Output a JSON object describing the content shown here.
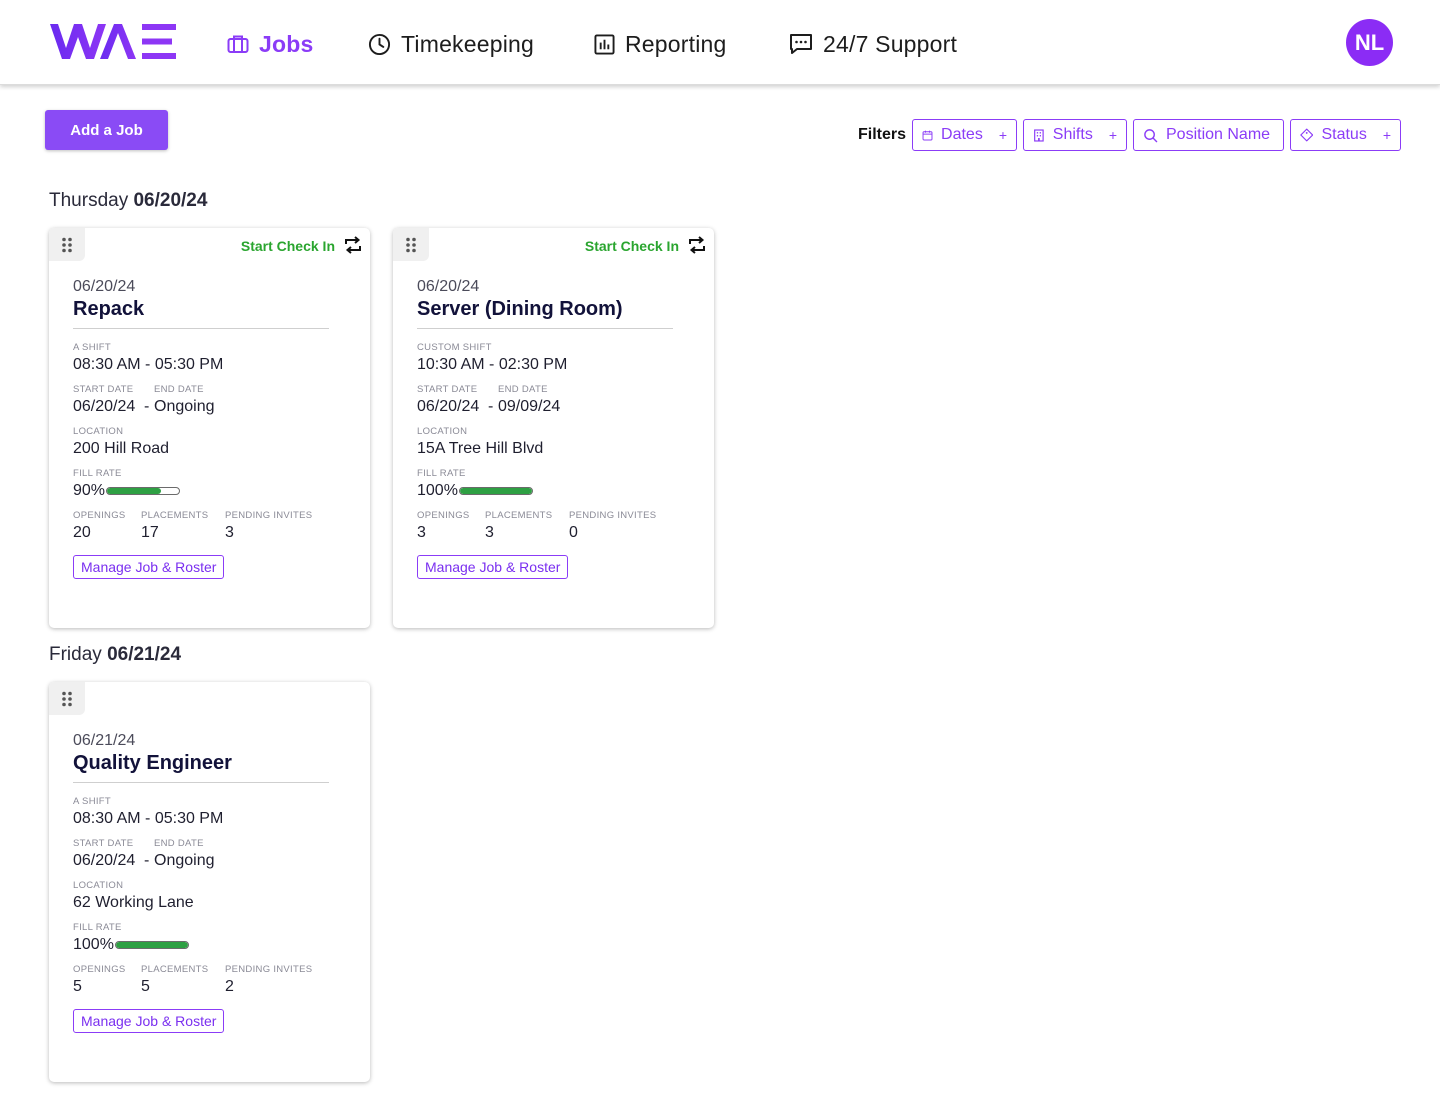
{
  "brand": {
    "logo_text": "WAE",
    "accent": "#8b3cf7",
    "success": "#2ea043"
  },
  "nav": {
    "items": [
      {
        "label": "Jobs",
        "icon": "briefcase-icon",
        "active": true
      },
      {
        "label": "Timekeeping",
        "icon": "clock-icon",
        "active": false
      },
      {
        "label": "Reporting",
        "icon": "bar-chart-icon",
        "active": false
      },
      {
        "label": "24/7 Support",
        "icon": "chat-icon",
        "active": false
      }
    ],
    "avatar_initials": "NL"
  },
  "toolbar": {
    "add_label": "Add a Job",
    "filters_label": "Filters",
    "filters": [
      {
        "label": "Dates",
        "icon": "calendar-icon"
      },
      {
        "label": "Shifts",
        "icon": "building-icon"
      },
      {
        "label": "Position Name",
        "icon": "search-icon"
      },
      {
        "label": "Status",
        "icon": "diamond-icon"
      }
    ]
  },
  "days": [
    {
      "weekday": "Thursday",
      "date": "06/20/24",
      "jobs": [
        {
          "checkin_label": "Start Check In",
          "date": "06/20/24",
          "title": "Repack",
          "shift_label": "A SHIFT",
          "shift_time": "08:30 AM - 05:30 PM",
          "start_date_label": "START DATE",
          "end_date_label": "END DATE",
          "start_date": "06/20/24",
          "end_date": "Ongoing",
          "location_label": "LOCATION",
          "location": "200 Hill Road",
          "fill_rate_label": "FILL RATE",
          "fill_rate": "90%",
          "fill_fraction": 0.75,
          "openings_label": "OPENINGS",
          "openings": "20",
          "placements_label": "PLACEMENTS",
          "placements": "17",
          "pending_label": "PENDING INVITES",
          "pending": "3",
          "manage_label": "Manage Job & Roster"
        },
        {
          "checkin_label": "Start Check In",
          "date": "06/20/24",
          "title": "Server (Dining Room)",
          "shift_label": "CUSTOM SHIFT",
          "shift_time": "10:30 AM - 02:30 PM",
          "start_date_label": "START DATE",
          "end_date_label": "END DATE",
          "start_date": "06/20/24",
          "end_date": "09/09/24",
          "location_label": "LOCATION",
          "location": "15A Tree Hill Blvd",
          "fill_rate_label": "FILL RATE",
          "fill_rate": "100%",
          "fill_fraction": 1.0,
          "openings_label": "OPENINGS",
          "openings": "3",
          "placements_label": "PLACEMENTS",
          "placements": "3",
          "pending_label": "PENDING INVITES",
          "pending": "0",
          "manage_label": "Manage Job & Roster"
        }
      ]
    },
    {
      "weekday": "Friday",
      "date": "06/21/24",
      "jobs": [
        {
          "checkin_label": "",
          "date": "06/21/24",
          "title": "Quality Engineer",
          "shift_label": "A SHIFT",
          "shift_time": "08:30 AM - 05:30 PM",
          "start_date_label": "START DATE",
          "end_date_label": "END DATE",
          "start_date": "06/20/24",
          "end_date": "Ongoing",
          "location_label": "LOCATION",
          "location": "62 Working Lane",
          "fill_rate_label": "FILL RATE",
          "fill_rate": "100%",
          "fill_fraction": 1.0,
          "openings_label": "OPENINGS",
          "openings": "5",
          "placements_label": "PLACEMENTS",
          "placements": "5",
          "pending_label": "PENDING INVITES",
          "pending": "2",
          "manage_label": "Manage Job & Roster"
        }
      ]
    }
  ]
}
